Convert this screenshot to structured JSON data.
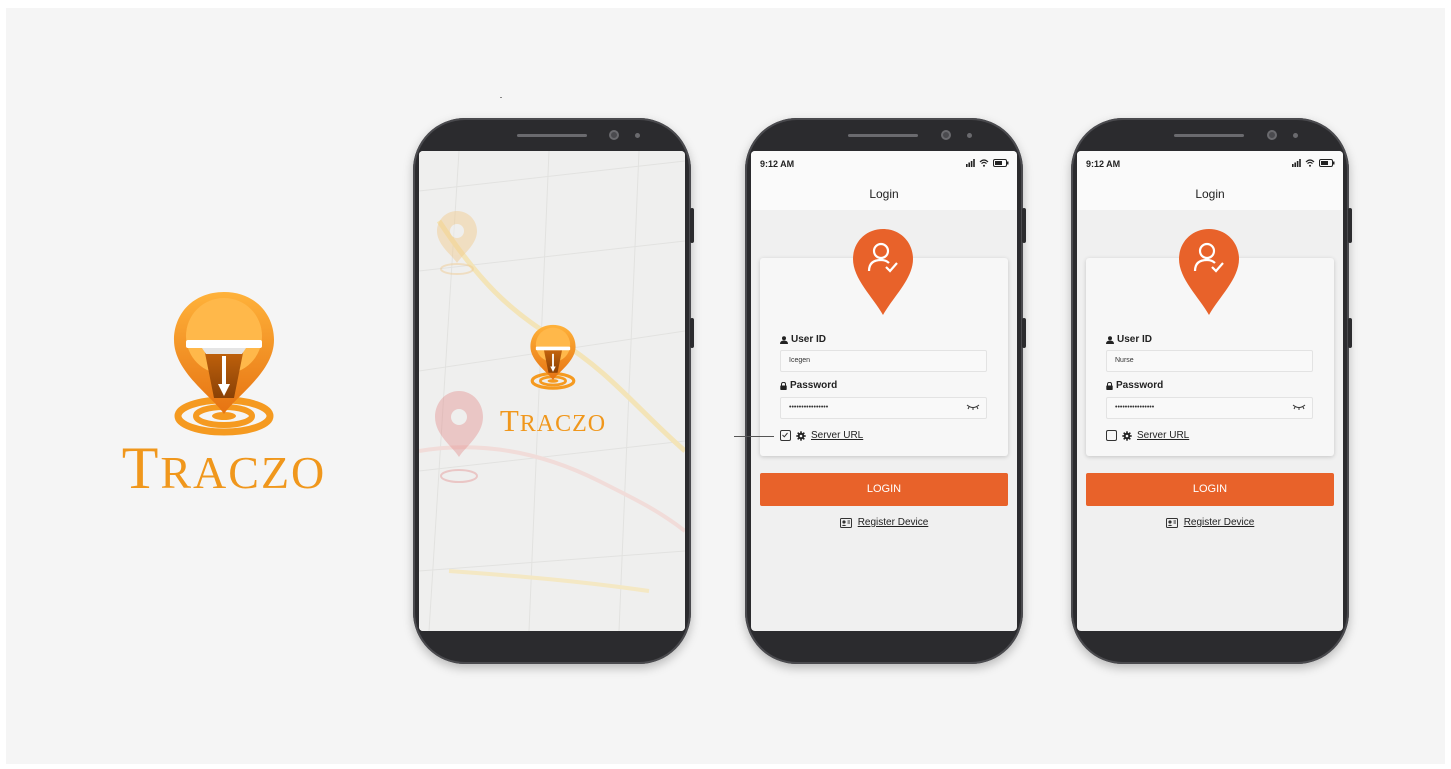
{
  "brand": {
    "wordmark_first": "T",
    "wordmark_rest": "RACZO",
    "primary_color": "#f0971c",
    "accent_color": "#e8622a"
  },
  "splash": {
    "wordmark_first": "T",
    "wordmark_rest": "RACZO"
  },
  "login_screens": [
    {
      "status_time": "9:12 AM",
      "title": "Login",
      "user_id_label": "User ID",
      "user_id_value": "Icegen",
      "password_label": "Password",
      "password_value": "••••••••••••••••",
      "server_checked": true,
      "server_label": "Server URL",
      "login_label": "LOGIN",
      "register_label": "Register Device"
    },
    {
      "status_time": "9:12 AM",
      "title": "Login",
      "user_id_label": "User ID",
      "user_id_value": "Nurse",
      "password_label": "Password",
      "password_value": "••••••••••••••••",
      "server_checked": false,
      "server_label": "Server URL",
      "login_label": "LOGIN",
      "register_label": "Register Device"
    }
  ],
  "icons": {
    "user": "user-icon",
    "lock": "lock-icon",
    "eye": "eye-closed-icon",
    "gear": "gear-icon",
    "checkbox": "checkbox-icon",
    "register": "device-register-icon",
    "avatar_pin": "user-check-pin-icon",
    "signal": "signal-icon",
    "wifi": "wifi-icon",
    "battery": "battery-icon"
  }
}
